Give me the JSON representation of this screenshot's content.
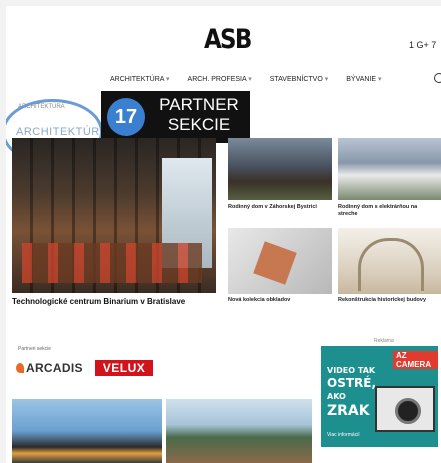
{
  "header": {
    "logo": "ASB",
    "top_right": "1 G+ 7"
  },
  "nav": {
    "items": [
      "ARCHITEKTÚRA",
      "ARCH. PROFESIA",
      "STAVEBNÍCTVO",
      "BÝVANIE"
    ]
  },
  "section": {
    "breadcrumb": "ARCHITEKTÚRA",
    "title": "ARCHITEKTÚRA"
  },
  "badge": {
    "number": "17",
    "line1": "PARTNER",
    "line2": "SEKCIE"
  },
  "hero": {
    "title": "Technologické centrum Binarium v Bratislave"
  },
  "thumbs": [
    {
      "caption": "Rodinný dom v Záhorskej Bystrici"
    },
    {
      "caption": "Rodinný dom s elektrárňou na streche"
    },
    {
      "caption": "Nová kolekcia obkladov"
    },
    {
      "caption": "Rekonštrukcia historickej budovy"
    }
  ],
  "partners": {
    "label": "Partneri sekcie",
    "arcadis": "ARCADIS",
    "velux": "VELUX"
  },
  "ad": {
    "label": "Reklama",
    "brand": "AZ CAMERA",
    "line1": "VIDEO TAK",
    "line2": "OSTRÉ,",
    "line3": "AKO",
    "line4": "ZRAK",
    "cta": "Viac informácií"
  },
  "colors": {
    "accent_blue": "#3b7fd0",
    "ring": "#6a9bd3",
    "velux_red": "#d1141b",
    "arcadis_orange": "#e8692a",
    "ad_teal": "#1d8f8f"
  }
}
